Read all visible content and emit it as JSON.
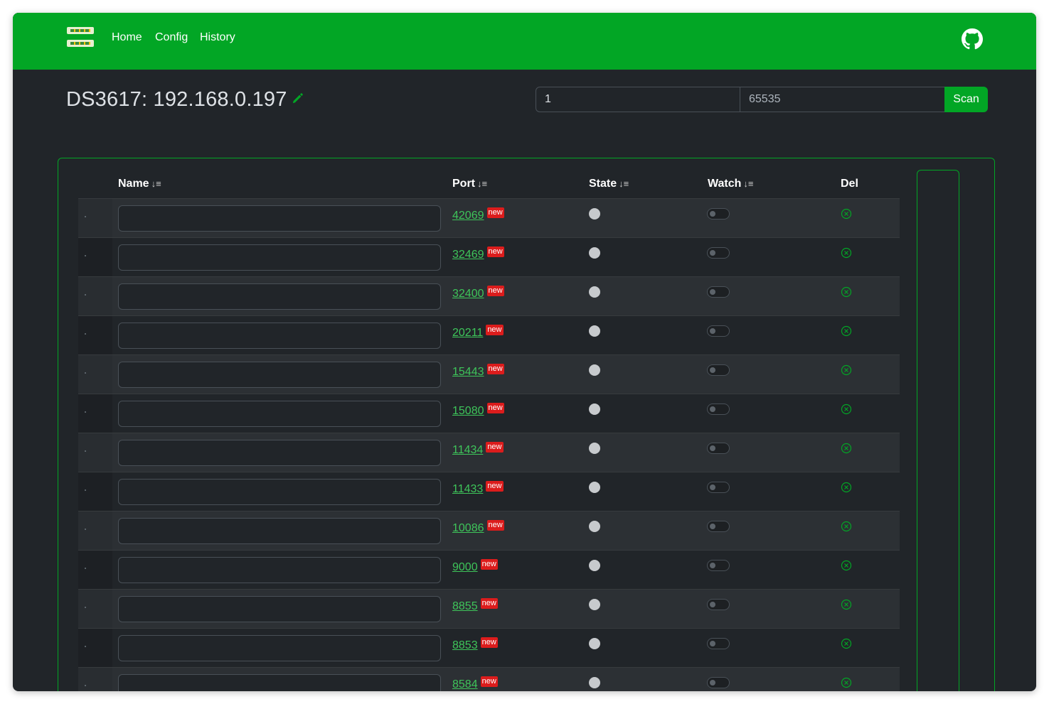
{
  "nav": {
    "links": [
      "Home",
      "Config",
      "History"
    ]
  },
  "header": {
    "title": "DS3617: 192.168.0.197"
  },
  "scan": {
    "start_value": "1",
    "end_value": "",
    "end_placeholder": "65535",
    "button_label": "Scan"
  },
  "table": {
    "columns": {
      "name": "Name",
      "port": "Port",
      "state": "State",
      "watch": "Watch",
      "del": "Del"
    },
    "badge_label": "new",
    "rows": [
      {
        "port": "42069",
        "name": ""
      },
      {
        "port": "32469",
        "name": ""
      },
      {
        "port": "32400",
        "name": ""
      },
      {
        "port": "20211",
        "name": ""
      },
      {
        "port": "15443",
        "name": ""
      },
      {
        "port": "15080",
        "name": ""
      },
      {
        "port": "11434",
        "name": ""
      },
      {
        "port": "11433",
        "name": ""
      },
      {
        "port": "10086",
        "name": ""
      },
      {
        "port": "9000",
        "name": ""
      },
      {
        "port": "8855",
        "name": ""
      },
      {
        "port": "8853",
        "name": ""
      },
      {
        "port": "8584",
        "name": ""
      }
    ]
  },
  "colors": {
    "accent": "#02a625",
    "background": "#212529",
    "link": "#3ec55a",
    "badge": "#dc1c1c"
  },
  "icons": {
    "logo": "server-rack-icon",
    "github": "github-icon",
    "edit": "pencil-icon",
    "delete": "circle-x-icon"
  }
}
